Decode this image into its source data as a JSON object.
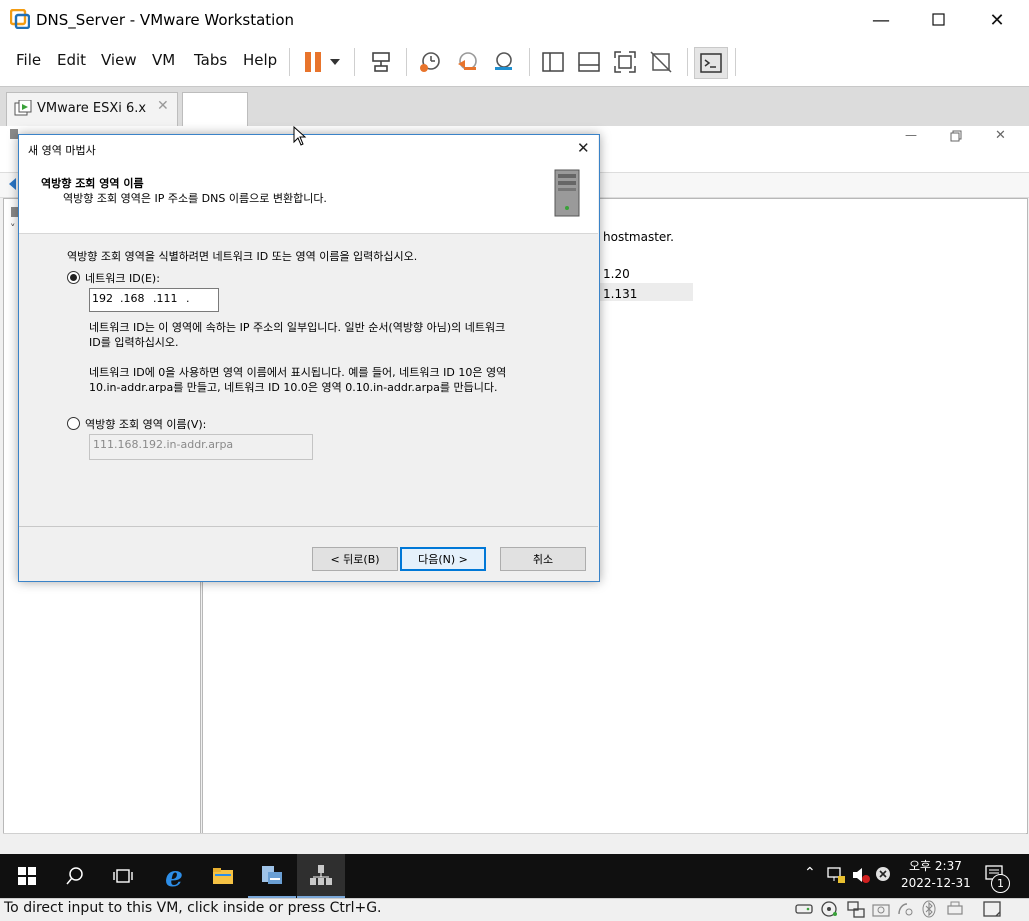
{
  "window": {
    "title": "DNS_Server - VMware Workstation"
  },
  "menu": [
    "File",
    "Edit",
    "View",
    "VM",
    "Tabs",
    "Help"
  ],
  "tabs": [
    {
      "label": "VMware ESXi 6.x"
    }
  ],
  "mmc": {
    "right_texts": [
      "hostmaster.",
      "1.20",
      "1.131"
    ]
  },
  "dialog": {
    "title": "새 영역 마법사",
    "header_title": "역방향 조회 영역 이름",
    "header_subtitle": "역방향 조회 영역은 IP 주소를 DNS 이름으로 변환합니다.",
    "instruction": "역방향 조회 영역을 식별하려면 네트워크 ID 또는 영역 이름을 입력하십시오.",
    "option_network_id": "네트워크 ID(E):",
    "network_id_octets": [
      "192",
      ".168",
      ".111",
      "."
    ],
    "desc1_line1": "네트워크 ID는 이 영역에 속하는 IP 주소의 일부입니다. 일반 순서(역방향 아님)의 네트워크",
    "desc1_line2": "ID를 입력하십시오.",
    "desc2_line1": "네트워크 ID에 0을 사용하면 영역 이름에서 표시됩니다. 예를 들어, 네트워크 ID 10은 영역",
    "desc2_line2": "10.in-addr.arpa를 만들고, 네트워크 ID 10.0은 영역 0.10.in-addr.arpa를 만듭니다.",
    "option_zone_name": "역방향 조회 영역 이름(V):",
    "zone_name_value": "111.168.192.in-addr.arpa",
    "selected_option": "network_id",
    "buttons": {
      "back": "< 뒤로(B)",
      "next": "다음(N) >",
      "cancel": "취소"
    }
  },
  "taskbar": {
    "time": "오후 2:37",
    "date": "2022-12-31",
    "notification_count": "1"
  },
  "vm_status": {
    "hint": "To direct input to this VM, click inside or press Ctrl+G."
  },
  "colors": {
    "pause_orange": "#e8742c",
    "dialog_border": "#3a83c8",
    "taskbar": "#101010"
  }
}
